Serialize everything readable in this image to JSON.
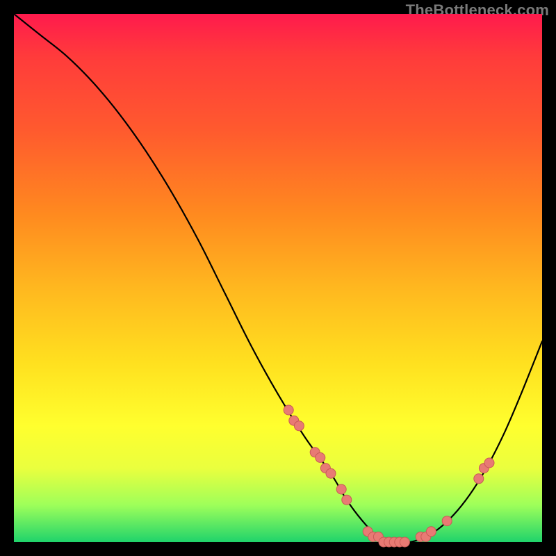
{
  "watermark": "TheBottleneck.com",
  "colors": {
    "background": "#000000",
    "curve": "#000000",
    "dot_fill": "#e87a74",
    "dot_stroke": "#c85a56"
  },
  "chart_data": {
    "type": "line",
    "title": "",
    "xlabel": "",
    "ylabel": "",
    "xlim": [
      0,
      100
    ],
    "ylim": [
      0,
      100
    ],
    "grid": false,
    "series": [
      {
        "name": "bottleneck-curve",
        "x": [
          0,
          5,
          10,
          15,
          20,
          25,
          30,
          35,
          40,
          45,
          50,
          55,
          60,
          63,
          66,
          69,
          72,
          75,
          78,
          81,
          84,
          87,
          90,
          93,
          96,
          100
        ],
        "y": [
          100,
          96,
          92,
          87,
          81,
          74,
          66,
          57,
          47,
          37,
          28,
          20,
          13,
          8,
          4,
          1,
          0,
          0,
          1,
          3,
          6,
          10,
          15,
          21,
          28,
          38
        ]
      }
    ],
    "points": [
      {
        "name": "cluster-left-upper",
        "x": 52,
        "y": 25
      },
      {
        "name": "cluster-left-upper",
        "x": 53,
        "y": 23
      },
      {
        "name": "cluster-left-upper",
        "x": 54,
        "y": 22
      },
      {
        "name": "cluster-left-mid",
        "x": 57,
        "y": 17
      },
      {
        "name": "cluster-left-mid",
        "x": 58,
        "y": 16
      },
      {
        "name": "cluster-left-mid",
        "x": 59,
        "y": 14
      },
      {
        "name": "cluster-left-mid",
        "x": 60,
        "y": 13
      },
      {
        "name": "cluster-left-low",
        "x": 62,
        "y": 10
      },
      {
        "name": "cluster-left-low",
        "x": 63,
        "y": 8
      },
      {
        "name": "valley-floor",
        "x": 67,
        "y": 2
      },
      {
        "name": "valley-floor",
        "x": 68,
        "y": 1
      },
      {
        "name": "valley-floor",
        "x": 69,
        "y": 1
      },
      {
        "name": "valley-floor",
        "x": 70,
        "y": 0
      },
      {
        "name": "valley-floor",
        "x": 71,
        "y": 0
      },
      {
        "name": "valley-floor",
        "x": 72,
        "y": 0
      },
      {
        "name": "valley-floor",
        "x": 73,
        "y": 0
      },
      {
        "name": "valley-floor",
        "x": 74,
        "y": 0
      },
      {
        "name": "valley-right-start",
        "x": 77,
        "y": 1
      },
      {
        "name": "valley-right-start",
        "x": 78,
        "y": 1
      },
      {
        "name": "valley-right-start",
        "x": 79,
        "y": 2
      },
      {
        "name": "right-rise",
        "x": 82,
        "y": 4
      },
      {
        "name": "right-upper",
        "x": 88,
        "y": 12
      },
      {
        "name": "right-upper",
        "x": 89,
        "y": 14
      },
      {
        "name": "right-upper",
        "x": 90,
        "y": 15
      }
    ]
  }
}
